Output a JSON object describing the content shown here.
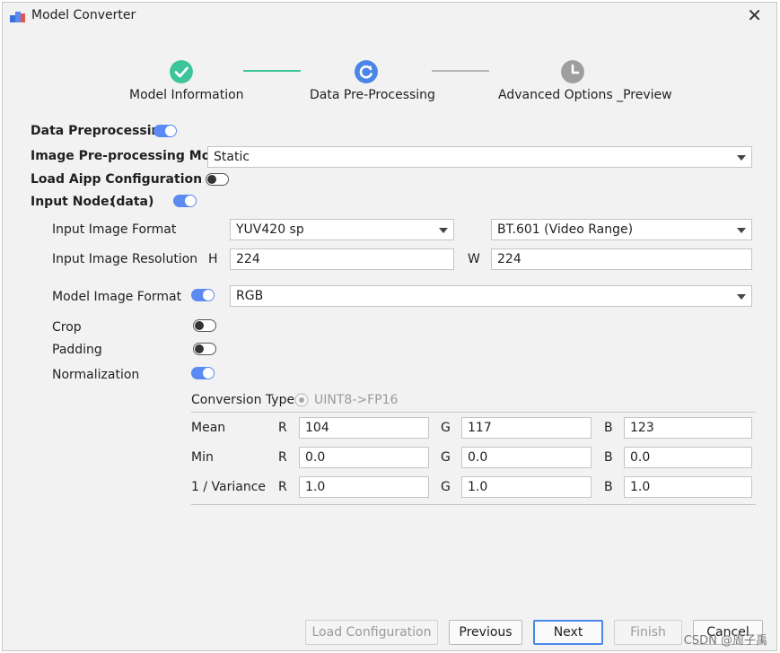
{
  "window": {
    "title": "Model Converter",
    "close_glyph": "✕"
  },
  "steps": [
    {
      "label": "Model Information",
      "state": "done",
      "icon": "check-icon"
    },
    {
      "label": "Data Pre-Processing",
      "state": "current",
      "icon": "refresh-icon"
    },
    {
      "label": "Advanced Options _Preview",
      "state": "pending",
      "icon": "clock-icon"
    }
  ],
  "colors": {
    "accent": "#5b8af2",
    "done": "#3cc49a",
    "pending": "#9e9e9e",
    "primary_border": "#4a86e8"
  },
  "data_preprocessing": {
    "label": "Data Preprocessing",
    "enabled": true
  },
  "mode": {
    "label": "Image Pre-processing Mode",
    "value": "Static"
  },
  "load_aipp": {
    "label": "Load Aipp Configuration",
    "enabled": false
  },
  "input_node": {
    "label": "Input Node:",
    "name": "(data)",
    "enabled": true
  },
  "input_format": {
    "label": "Input Image Format",
    "value": "YUV420 sp",
    "color_range": "BT.601 (Video Range)"
  },
  "resolution": {
    "label": "Input Image Resolution",
    "h_label": "H",
    "h_value": "224",
    "w_label": "W",
    "w_value": "224"
  },
  "model_format": {
    "label": "Model Image Format",
    "enabled": true,
    "value": "RGB"
  },
  "crop": {
    "label": "Crop",
    "enabled": false
  },
  "padding": {
    "label": "Padding",
    "enabled": false
  },
  "normalization": {
    "label": "Normalization",
    "enabled": true
  },
  "conversion": {
    "label": "Conversion Type",
    "option": "UINT8->FP16"
  },
  "channel_labels": {
    "r": "R",
    "g": "G",
    "b": "B"
  },
  "norm_rows": [
    {
      "label": "Mean",
      "r": "104",
      "g": "117",
      "b": "123"
    },
    {
      "label": "Min",
      "r": "0.0",
      "g": "0.0",
      "b": "0.0"
    },
    {
      "label": "1 / Variance",
      "r": "1.0",
      "g": "1.0",
      "b": "1.0"
    }
  ],
  "buttons": {
    "load_config": "Load Configuration",
    "previous": "Previous",
    "next": "Next",
    "finish": "Finish",
    "cancel": "Cancel"
  },
  "watermark": "CSDN @周子禹"
}
